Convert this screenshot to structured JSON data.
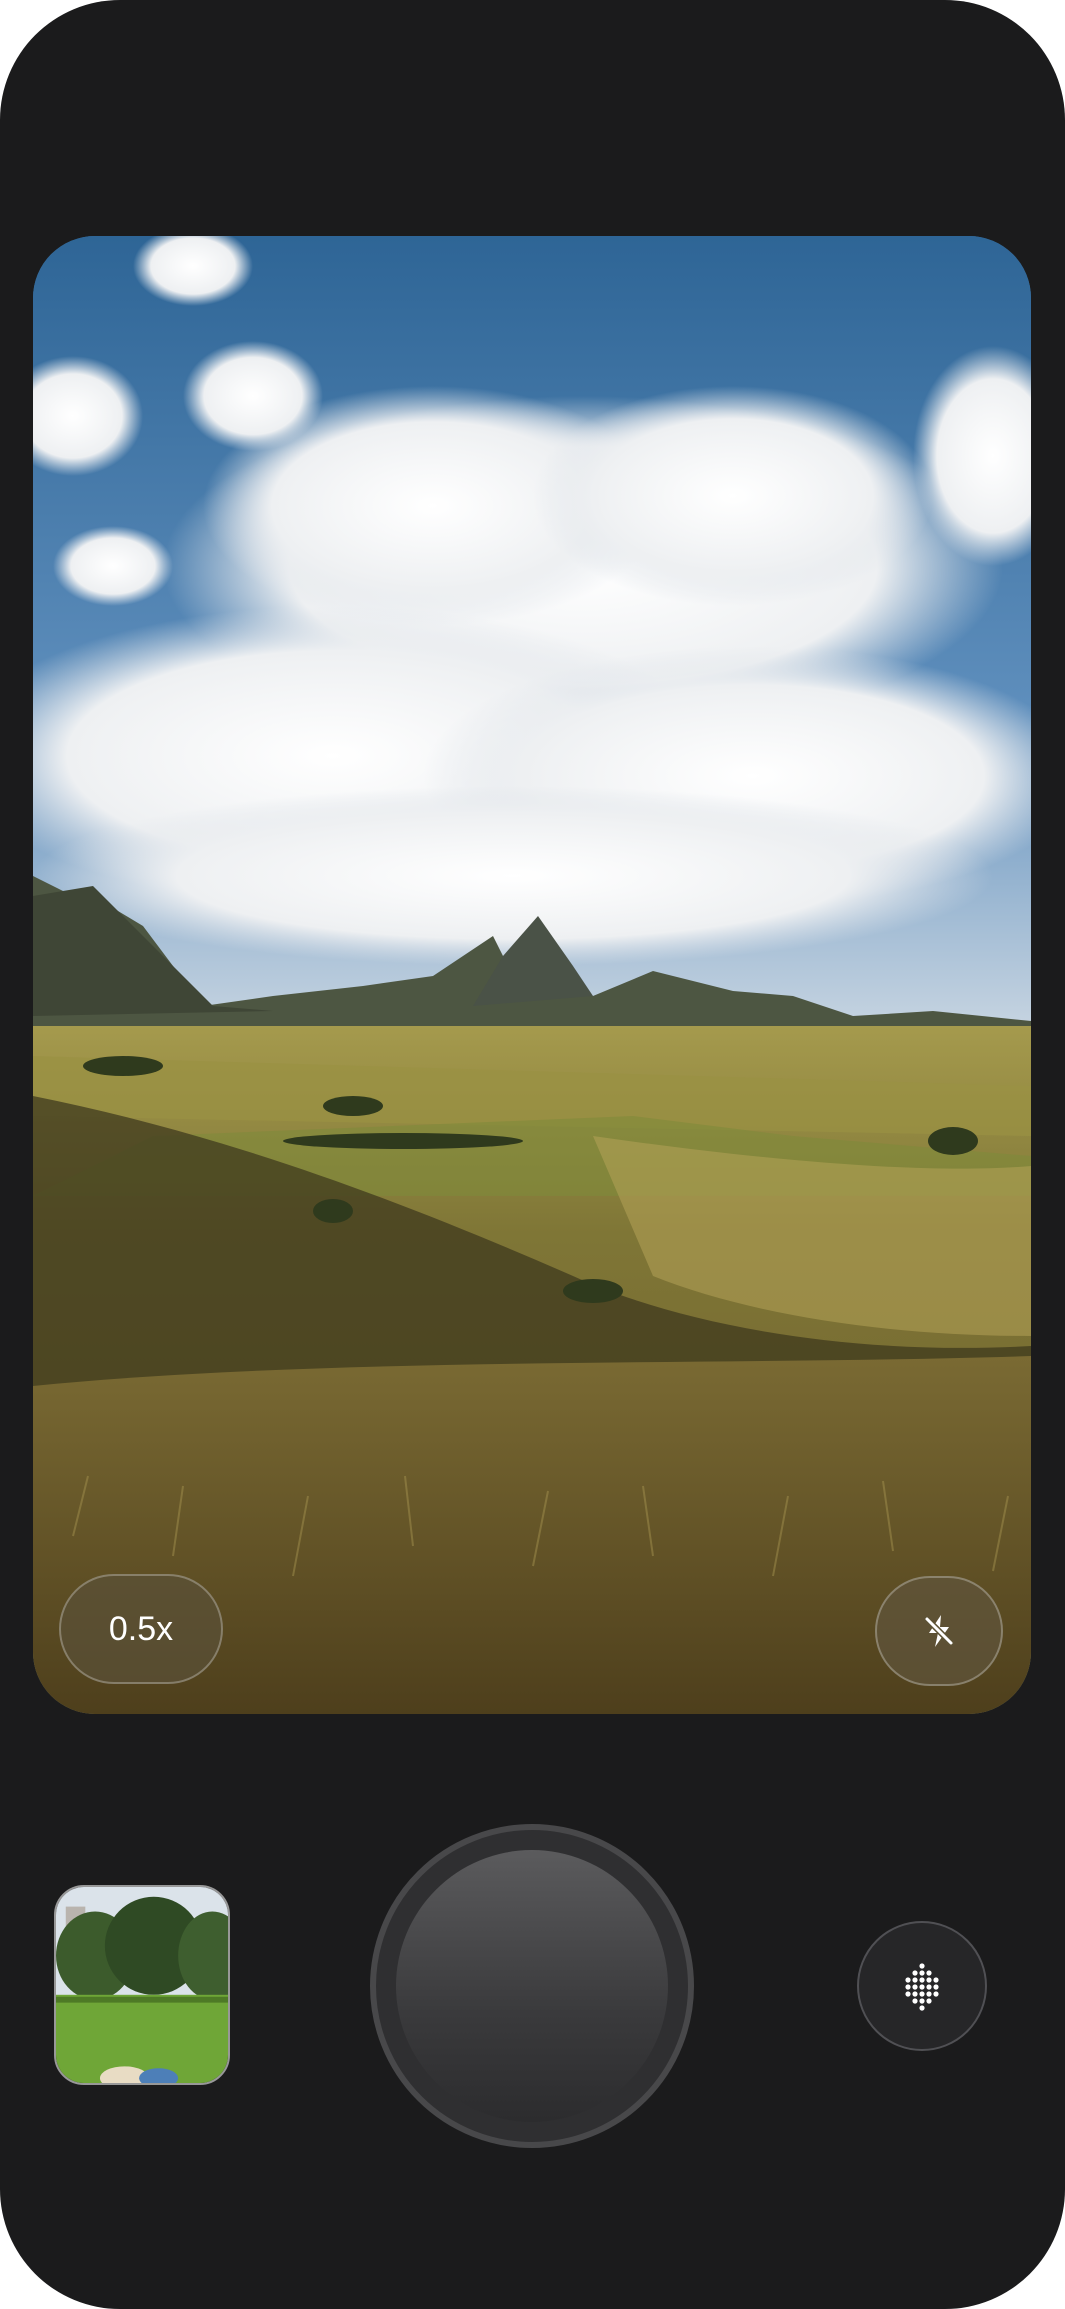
{
  "viewfinder": {
    "zoom_label": "0.5x"
  },
  "icons": {
    "flash": "flash-off-icon",
    "mode": "dot-grid-icon"
  },
  "colors": {
    "body": "#1b1b1c",
    "sky": "#3c6f9a",
    "grass": "#8a7436",
    "shutter": "#4a4a4c"
  }
}
